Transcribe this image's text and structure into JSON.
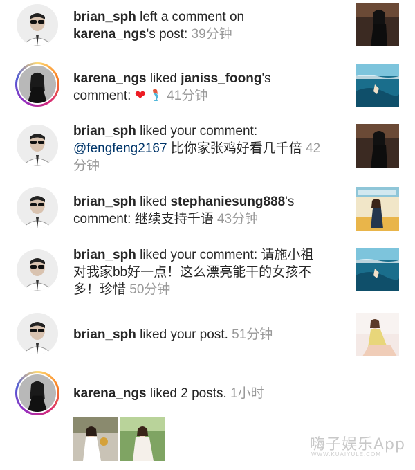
{
  "notifications": [
    {
      "user": "brian_sph",
      "action": " left a comment on",
      "target_user": "karena_ngs",
      "target_suffix": "'s post:",
      "time": "39分钟"
    },
    {
      "user": "karena_ngs",
      "action": " liked ",
      "target_user": "janiss_foong",
      "target_suffix": "'s",
      "line2": "comment:",
      "emoji_heart": "❤️",
      "emoji_mermaid": "mermaid-emoji",
      "time": "41分钟"
    },
    {
      "user": "brian_sph",
      "action": " liked your comment:",
      "mention": "@fengfeng2167",
      "comment": " 比你家张鸡好看几千倍",
      "time_part1": "42",
      "time_part2": "分钟"
    },
    {
      "user": "brian_sph",
      "action": " liked ",
      "target_user": "stephaniesung888",
      "target_suffix": "'s",
      "line2": "comment: 继续支持千语",
      "time": "43分钟"
    },
    {
      "user": "brian_sph",
      "action": " liked your comment: 请施小祖",
      "line2": "对我家bb好一点！这么漂亮能干的女孩不",
      "line3": "多！珍惜",
      "time": "50分钟"
    },
    {
      "user": "brian_sph",
      "action": " liked your post.",
      "time": "51分钟"
    },
    {
      "user": "karena_ngs",
      "action": " liked 2 posts.",
      "time": "1小时"
    }
  ],
  "watermark": {
    "title": "嗨子娱乐App",
    "subtitle": "WWW.KUAIYULE.COM"
  },
  "colors": {
    "text": "#262626",
    "time": "#999999",
    "link_mention": "#003569",
    "story_ring": "#d62976"
  }
}
